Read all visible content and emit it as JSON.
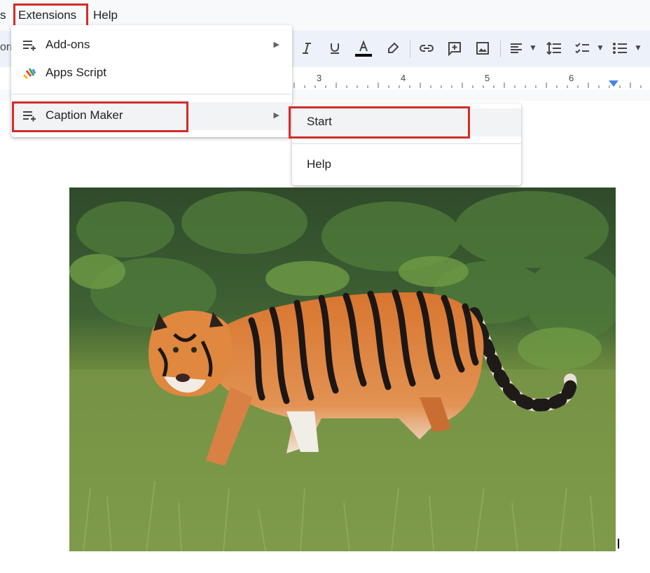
{
  "menubar": {
    "partial_label": "s",
    "extensions_label": "Extensions",
    "help_label": "Help"
  },
  "toolbar": {
    "partial_text": "orm",
    "icons": [
      "italic-icon",
      "underline-icon",
      "text-color-icon",
      "highlight-icon",
      "link-icon",
      "comment-icon",
      "image-icon",
      "align-icon",
      "line-spacing-icon",
      "checklist-icon",
      "bullet-list-icon"
    ]
  },
  "ruler": {
    "numbers": [
      "3",
      "4",
      "5",
      "6"
    ]
  },
  "extensions_menu": {
    "items": [
      {
        "label": "Add-ons",
        "icon": "add-ons-icon",
        "has_submenu": true
      },
      {
        "label": "Apps Script",
        "icon": "apps-script-icon",
        "has_submenu": false
      },
      {
        "label": "Caption Maker",
        "icon": "caption-maker-icon",
        "has_submenu": true
      }
    ]
  },
  "caption_submenu": {
    "items": [
      {
        "label": "Start"
      },
      {
        "label": "Help"
      }
    ]
  },
  "document": {
    "image_subject": "tiger-photo"
  },
  "colors": {
    "highlight_red": "#d12c2c",
    "toolbar_bg": "#edf2fa",
    "ruler_marker": "#4a86e8"
  }
}
